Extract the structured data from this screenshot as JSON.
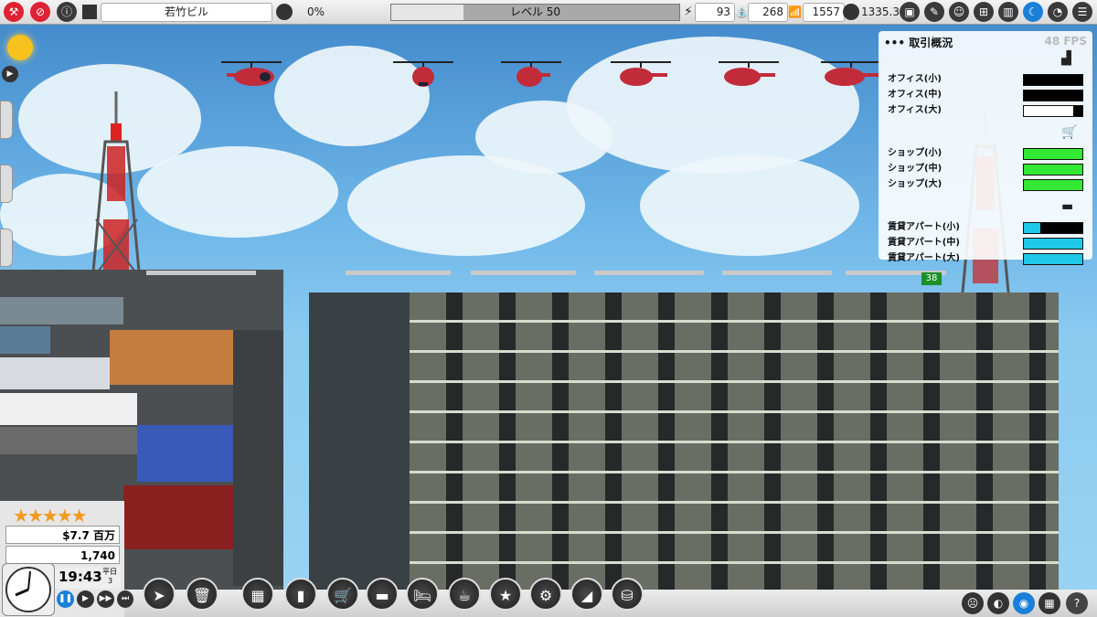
{
  "topbar": {
    "building_name": "若竹ビル",
    "rating_percent": "0%",
    "level_label": "レベル 50",
    "level_progress": 0.25,
    "power": "93",
    "water": "268",
    "signal": "1557",
    "coins": "1335.3"
  },
  "trade_panel": {
    "title": "取引概況",
    "fps": "48 FPS",
    "groups": [
      {
        "icon": "office-icon",
        "rows": [
          {
            "label": "オフィス(小)",
            "level": 0.0,
            "color": "#000000"
          },
          {
            "label": "オフィス(中)",
            "level": 0.0,
            "color": "#000000"
          },
          {
            "label": "オフィス(大)",
            "level": 0.85,
            "color": "#ffffff"
          }
        ]
      },
      {
        "icon": "cart-icon",
        "rows": [
          {
            "label": "ショップ(小)",
            "level": 1.0,
            "color": "#33e833"
          },
          {
            "label": "ショップ(中)",
            "level": 1.0,
            "color": "#33e833"
          },
          {
            "label": "ショップ(大)",
            "level": 1.0,
            "color": "#33e833"
          }
        ]
      },
      {
        "icon": "sofa-icon",
        "rows": [
          {
            "label": "賃貸アパート(小)",
            "level": 0.28,
            "color": "#1ec8e8"
          },
          {
            "label": "賃貸アパート(中)",
            "level": 1.0,
            "color": "#1ec8e8"
          },
          {
            "label": "賃貸アパート(大)",
            "level": 1.0,
            "color": "#1ec8e8"
          }
        ]
      }
    ]
  },
  "status": {
    "money": "$7.7 百万",
    "population": "1,740",
    "time": "19:43",
    "day_type": "平日",
    "day_number": "3",
    "stars": 5
  },
  "hud_counter": "38"
}
